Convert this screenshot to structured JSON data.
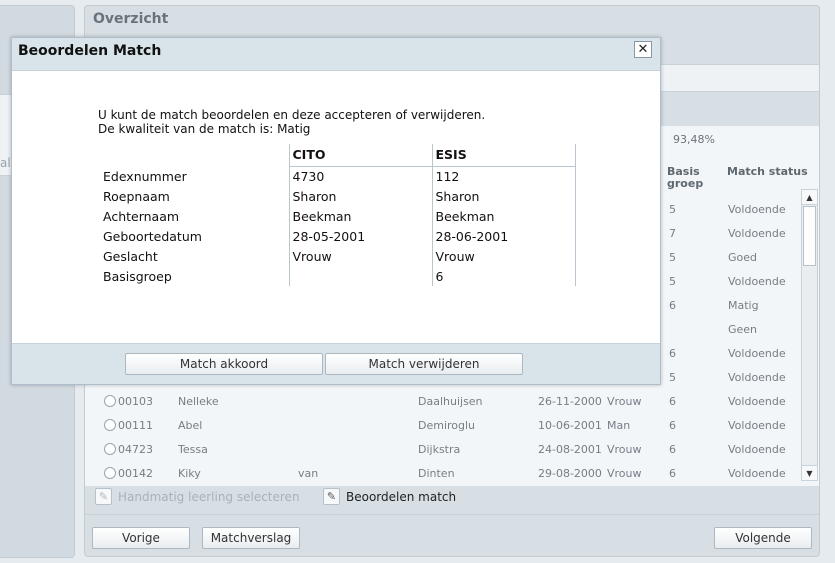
{
  "main": {
    "title": "Overzicht",
    "percentage": "93,48%",
    "columns": {
      "basis_groep": "Basis groep",
      "match_status": "Match status"
    },
    "rows": [
      {
        "number": "",
        "first_name": "",
        "prefix": "",
        "last_name": "",
        "birth_date": "",
        "gender": "",
        "group": "5",
        "status": "Voldoende"
      },
      {
        "number": "",
        "first_name": "",
        "prefix": "",
        "last_name": "",
        "birth_date": "",
        "gender": "",
        "group": "7",
        "status": "Voldoende"
      },
      {
        "number": "",
        "first_name": "",
        "prefix": "",
        "last_name": "",
        "birth_date": "",
        "gender": "",
        "group": "5",
        "status": "Goed"
      },
      {
        "number": "",
        "first_name": "",
        "prefix": "",
        "last_name": "",
        "birth_date": "",
        "gender": "",
        "group": "5",
        "status": "Voldoende"
      },
      {
        "number": "",
        "first_name": "",
        "prefix": "",
        "last_name": "",
        "birth_date": "",
        "gender": "",
        "group": "6",
        "status": "Matig"
      },
      {
        "number": "",
        "first_name": "",
        "prefix": "",
        "last_name": "",
        "birth_date": "",
        "gender": "",
        "group": "",
        "status": "Geen"
      },
      {
        "number": "",
        "first_name": "",
        "prefix": "",
        "last_name": "",
        "birth_date": "",
        "gender": "",
        "group": "6",
        "status": "Voldoende"
      },
      {
        "number": "",
        "first_name": "",
        "prefix": "",
        "last_name": "",
        "birth_date": "",
        "gender": "",
        "group": "5",
        "status": "Voldoende"
      },
      {
        "number": "00103",
        "first_name": "Nelleke",
        "prefix": "",
        "last_name": "Daalhuijsen",
        "birth_date": "26-11-2000",
        "gender": "Vrouw",
        "group": "6",
        "status": "Voldoende"
      },
      {
        "number": "00111",
        "first_name": "Abel",
        "prefix": "",
        "last_name": "Demiroglu",
        "birth_date": "10-06-2001",
        "gender": "Man",
        "group": "6",
        "status": "Voldoende"
      },
      {
        "number": "04723",
        "first_name": "Tessa",
        "prefix": "",
        "last_name": "Dijkstra",
        "birth_date": "24-08-2001",
        "gender": "Vrouw",
        "group": "6",
        "status": "Voldoende"
      },
      {
        "number": "00142",
        "first_name": "Kiky",
        "prefix": "van",
        "last_name": "Dinten",
        "birth_date": "29-08-2000",
        "gender": "Vrouw",
        "group": "6",
        "status": "Voldoende"
      }
    ],
    "tools": {
      "manual_select": "Handmatig leerling selecteren",
      "review_match": "Beoordelen match"
    },
    "footer": {
      "previous": "Vorige",
      "match_report": "Matchverslag",
      "next": "Volgende"
    }
  },
  "modal": {
    "title": "Beoordelen Match",
    "close_symbol": "✕",
    "intro_line1": "U kunt de match beoordelen en deze accepteren of verwijderen.",
    "intro_line2": "De kwaliteit van de match is: Matig",
    "col_cito": "CITO",
    "col_esis": "ESIS",
    "fields": [
      {
        "label": "Edexnummer",
        "cito": "4730",
        "esis": "112"
      },
      {
        "label": "Roepnaam",
        "cito": "Sharon",
        "esis": "Sharon"
      },
      {
        "label": "Achternaam",
        "cito": "Beekman",
        "esis": "Beekman"
      },
      {
        "label": "Geboortedatum",
        "cito": "28-05-2001",
        "esis": "28-06-2001"
      },
      {
        "label": "Geslacht",
        "cito": "Vrouw",
        "esis": "Vrouw"
      },
      {
        "label": "Basisgroep",
        "cito": "",
        "esis": "6"
      }
    ],
    "accept_button": "Match akkoord",
    "delete_button": "Match verwijderen"
  },
  "left_panel_fragment": "al"
}
